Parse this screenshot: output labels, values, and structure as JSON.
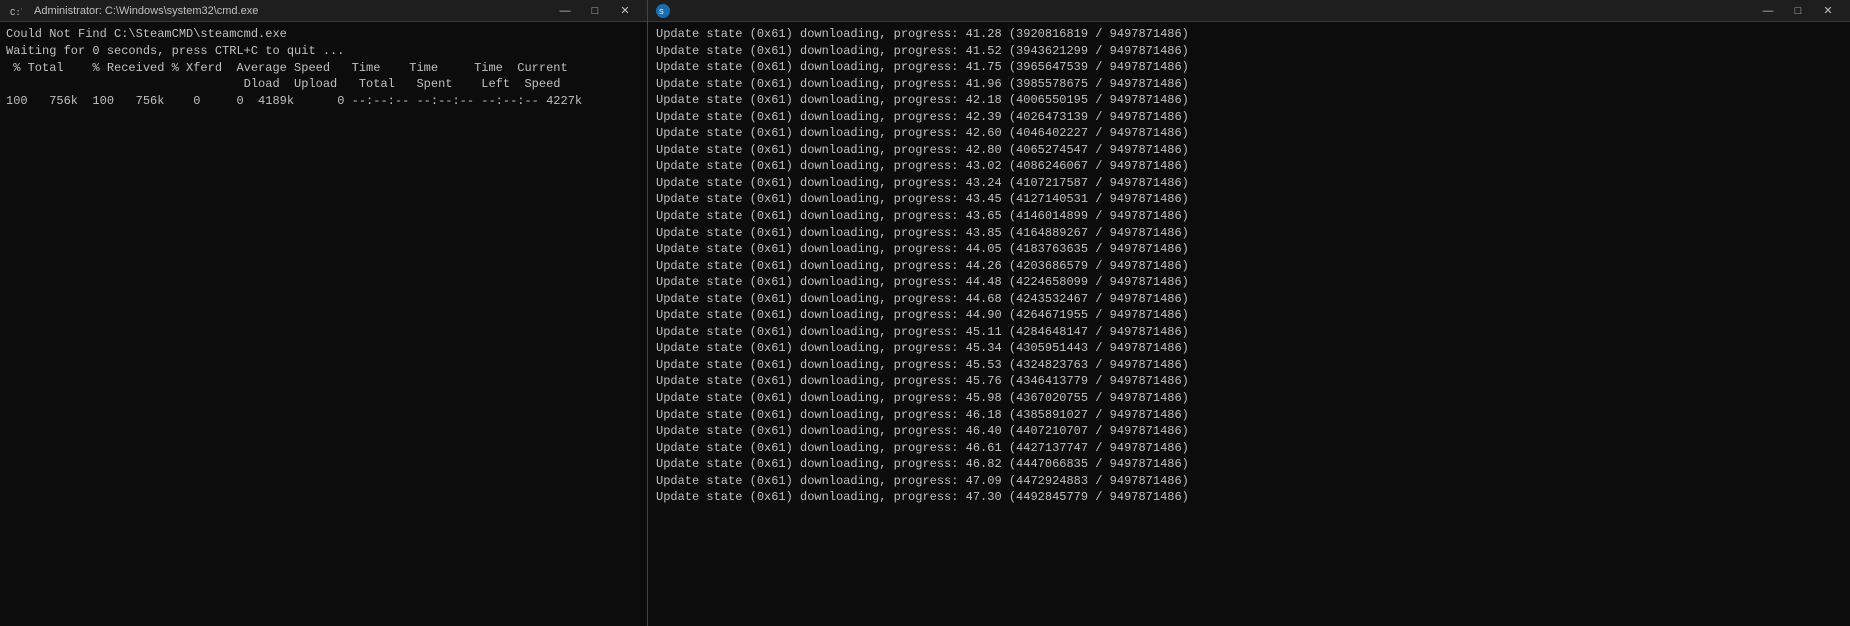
{
  "cmd_window": {
    "title": "Administrator: C:\\Windows\\system32\\cmd.exe",
    "icon": "C",
    "lines": [
      "Could Not Find C:\\SteamCMD\\steamcmd.exe",
      "",
      "Waiting for 0 seconds, press CTRL+C to quit ...",
      " % Total    % Received % Xferd  Average Speed   Time    Time     Time  Current",
      "                                 Dload  Upload   Total   Spent    Left  Speed",
      "100   756k  100   756k    0     0  4189k      0 --:--:-- --:--:-- --:--:-- 4227k"
    ],
    "controls": {
      "minimize": "—",
      "maximize": "□",
      "close": "✕"
    }
  },
  "steam_window": {
    "title": "",
    "lines": [
      "Update state (0x61) downloading, progress: 41.28 (3920816819 / 9497871486)",
      "Update state (0x61) downloading, progress: 41.52 (3943621299 / 9497871486)",
      "Update state (0x61) downloading, progress: 41.75 (3965647539 / 9497871486)",
      "Update state (0x61) downloading, progress: 41.96 (3985578675 / 9497871486)",
      "Update state (0x61) downloading, progress: 42.18 (4006550195 / 9497871486)",
      "Update state (0x61) downloading, progress: 42.39 (4026473139 / 9497871486)",
      "Update state (0x61) downloading, progress: 42.60 (4046402227 / 9497871486)",
      "Update state (0x61) downloading, progress: 42.80 (4065274547 / 9497871486)",
      "Update state (0x61) downloading, progress: 43.02 (4086246067 / 9497871486)",
      "Update state (0x61) downloading, progress: 43.24 (4107217587 / 9497871486)",
      "Update state (0x61) downloading, progress: 43.45 (4127140531 / 9497871486)",
      "Update state (0x61) downloading, progress: 43.65 (4146014899 / 9497871486)",
      "Update state (0x61) downloading, progress: 43.85 (4164889267 / 9497871486)",
      "Update state (0x61) downloading, progress: 44.05 (4183763635 / 9497871486)",
      "Update state (0x61) downloading, progress: 44.26 (4203686579 / 9497871486)",
      "Update state (0x61) downloading, progress: 44.48 (4224658099 / 9497871486)",
      "Update state (0x61) downloading, progress: 44.68 (4243532467 / 9497871486)",
      "Update state (0x61) downloading, progress: 44.90 (4264671955 / 9497871486)",
      "Update state (0x61) downloading, progress: 45.11 (4284648147 / 9497871486)",
      "Update state (0x61) downloading, progress: 45.34 (4305951443 / 9497871486)",
      "Update state (0x61) downloading, progress: 45.53 (4324823763 / 9497871486)",
      "Update state (0x61) downloading, progress: 45.76 (4346413779 / 9497871486)",
      "Update state (0x61) downloading, progress: 45.98 (4367020755 / 9497871486)",
      "Update state (0x61) downloading, progress: 46.18 (4385891027 / 9497871486)",
      "Update state (0x61) downloading, progress: 46.40 (4407210707 / 9497871486)",
      "Update state (0x61) downloading, progress: 46.61 (4427137747 / 9497871486)",
      "Update state (0x61) downloading, progress: 46.82 (4447066835 / 9497871486)",
      "Update state (0x61) downloading, progress: 47.09 (4472924883 / 9497871486)",
      "Update state (0x61) downloading, progress: 47.30 (4492845779 / 9497871486)"
    ],
    "controls": {
      "minimize": "—",
      "maximize": "□",
      "close": "✕"
    }
  }
}
